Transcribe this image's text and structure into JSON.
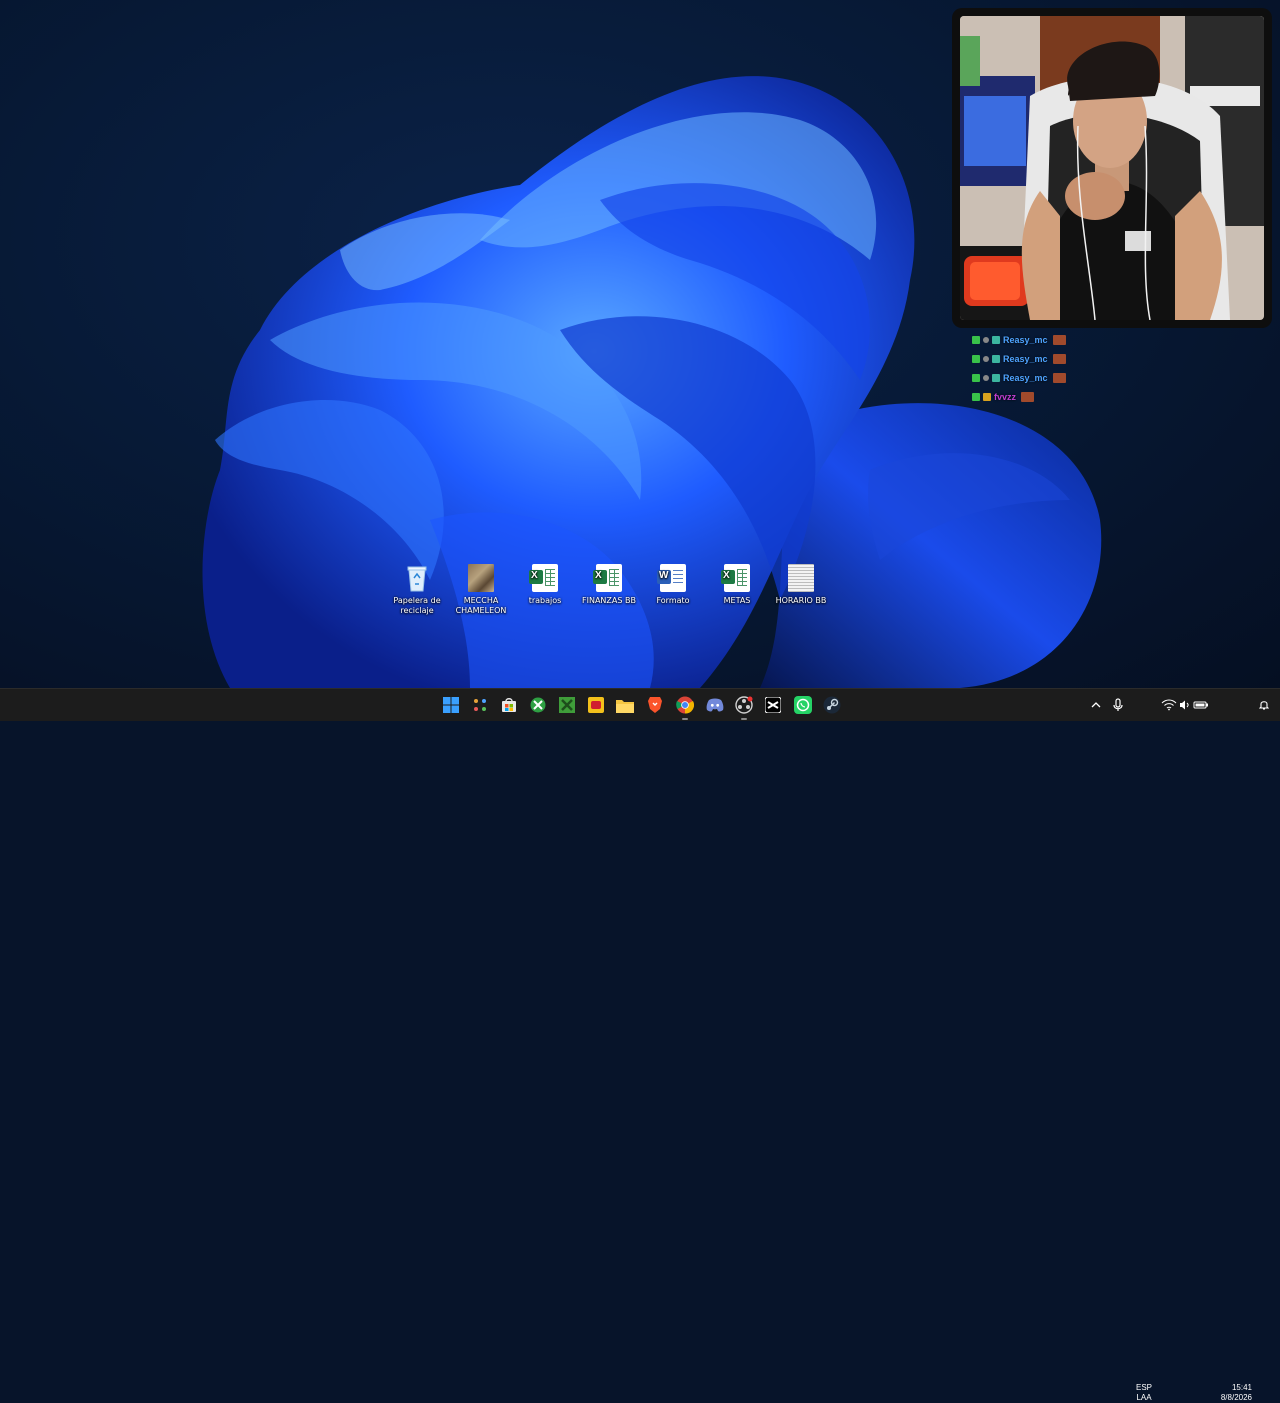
{
  "desktop": {
    "icons": [
      {
        "label": "Papelera de reciclaje",
        "icon": "recycle-bin-icon"
      },
      {
        "label": "MECCHA CHAMELEON",
        "icon": "game-shortcut-icon"
      },
      {
        "label": "trabajos",
        "icon": "excel-file-icon"
      },
      {
        "label": "FINANZAS BB",
        "icon": "excel-file-icon"
      },
      {
        "label": "Formato",
        "icon": "word-file-icon"
      },
      {
        "label": "METAS",
        "icon": "excel-file-icon"
      },
      {
        "label": "HORARIO BB",
        "icon": "text-file-icon"
      }
    ]
  },
  "chat": {
    "messages": [
      {
        "user": "Reasy_mc",
        "color": "#2a86d6"
      },
      {
        "user": "Reasy_mc",
        "color": "#2a86d6"
      },
      {
        "user": "Reasy_mc",
        "color": "#2a86d6"
      },
      {
        "user": "fvvzz",
        "color": "#c03fd0"
      }
    ]
  },
  "taskbar": {
    "apps": [
      "start-icon",
      "widgets-icon",
      "store-icon",
      "xbox-icon",
      "minecraft-icon",
      "game-app-icon",
      "file-explorer-icon",
      "brave-icon",
      "chrome-icon",
      "discord-icon",
      "obs-icon",
      "capcut-icon",
      "whatsapp-icon",
      "steam-icon"
    ],
    "tray": {
      "language_top": "ESP",
      "language_bottom": "LAA",
      "time": "15:41",
      "date": "8/8/2026"
    }
  },
  "colors": {
    "taskbar_bg": "#1c1c1c",
    "wallpaper_accent": "#1f5cff"
  }
}
